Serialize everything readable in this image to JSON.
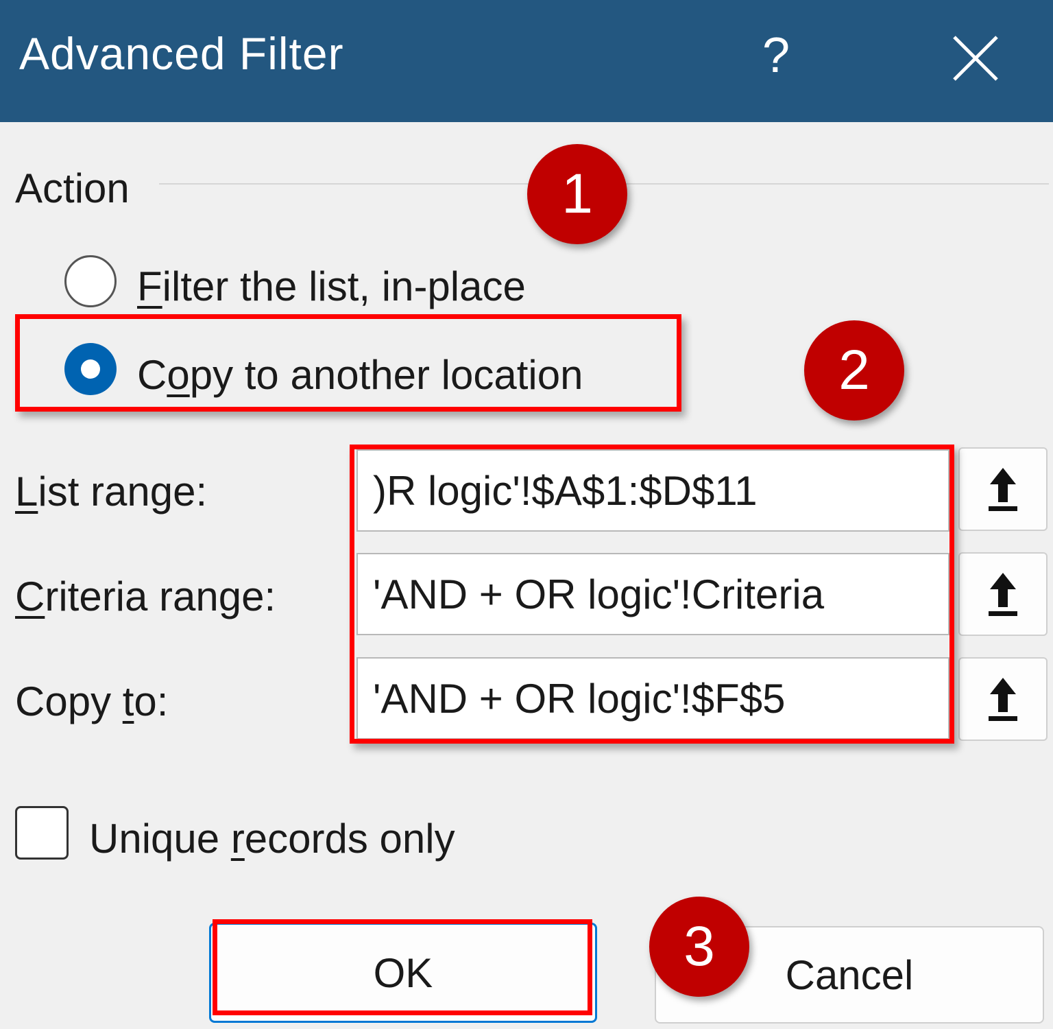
{
  "dialog": {
    "title": "Advanced Filter",
    "help": "?",
    "close_icon": "close-icon"
  },
  "action": {
    "label": "Action"
  },
  "options": [
    {
      "pre": "",
      "key": "F",
      "post": "ilter the list, in-place",
      "selected": false
    },
    {
      "pre": "C",
      "key": "o",
      "post": "py to another location",
      "selected": true
    }
  ],
  "fields": [
    {
      "pre": "",
      "key": "L",
      "post": "ist range:",
      "value": ")R logic'!$A$1:$D$11"
    },
    {
      "pre": "",
      "key": "C",
      "post": "riteria range:",
      "value": "'AND + OR logic'!Criteria"
    },
    {
      "pre": "Copy ",
      "key": "t",
      "post": "o:",
      "value": "'AND + OR logic'!$F$5"
    }
  ],
  "unique": {
    "pre": "Unique ",
    "key": "r",
    "post": "ecords only",
    "checked": false
  },
  "buttons": {
    "ok": "OK",
    "cancel": "Cancel"
  },
  "badges": [
    "1",
    "2",
    "3"
  ],
  "colors": {
    "titlebar": "#235780",
    "highlight": "#ff0000",
    "badge": "#c00000",
    "radio": "#0063b1"
  }
}
